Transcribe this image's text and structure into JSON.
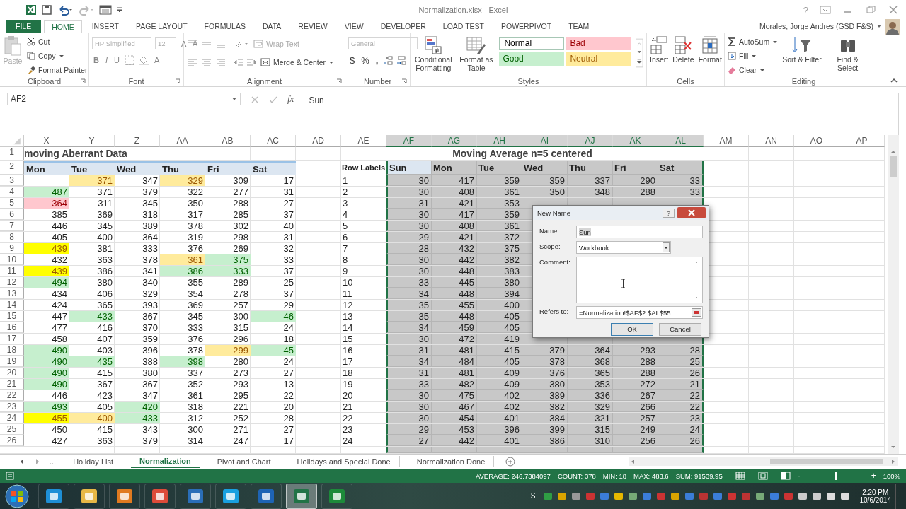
{
  "window": {
    "title": "Normalization.xlsx - Excel",
    "help": "?"
  },
  "menu_tabs": [
    {
      "label": "FILE",
      "kind": "file",
      "selected": false
    },
    {
      "label": "HOME",
      "kind": "tab",
      "selected": true
    },
    {
      "label": "INSERT",
      "kind": "tab",
      "selected": false
    },
    {
      "label": "PAGE LAYOUT",
      "kind": "tab",
      "selected": false
    },
    {
      "label": "FORMULAS",
      "kind": "tab",
      "selected": false
    },
    {
      "label": "DATA",
      "kind": "tab",
      "selected": false
    },
    {
      "label": "REVIEW",
      "kind": "tab",
      "selected": false
    },
    {
      "label": "VIEW",
      "kind": "tab",
      "selected": false
    },
    {
      "label": "DEVELOPER",
      "kind": "tab",
      "selected": false
    },
    {
      "label": "LOAD TEST",
      "kind": "tab",
      "selected": false
    },
    {
      "label": "POWERPIVOT",
      "kind": "tab",
      "selected": false
    },
    {
      "label": "TEAM",
      "kind": "tab",
      "selected": false
    }
  ],
  "user": {
    "name": "Morales, Jorge Andres (GSD F&S)"
  },
  "ribbon": {
    "clipboard": {
      "label": "Clipboard",
      "paste": "Paste",
      "cut": "Cut",
      "copy": "Copy",
      "format_painter": "Format Painter"
    },
    "font": {
      "label": "Font",
      "font_name": "HP Simplified",
      "font_size": "12",
      "grow": "A",
      "shrink": "A",
      "bold": "B",
      "italic": "I",
      "underline": "U",
      "font_color": "A"
    },
    "alignment": {
      "label": "Alignment",
      "wrap_text": "Wrap Text",
      "merge_center": "Merge & Center"
    },
    "number": {
      "label": "Number",
      "format": "General",
      "currency": "$",
      "percent": "%",
      "comma": ","
    },
    "styles": {
      "label": "Styles",
      "conditional": "Conditional Formatting",
      "format_table": "Format as Table",
      "cell_styles": [
        {
          "label": "Normal",
          "kind": "normal"
        },
        {
          "label": "Bad",
          "kind": "bad"
        },
        {
          "label": "Good",
          "kind": "good"
        },
        {
          "label": "Neutral",
          "kind": "neutral"
        }
      ]
    },
    "cells": {
      "label": "Cells",
      "insert": "Insert",
      "delete": "Delete",
      "format": "Format"
    },
    "editing": {
      "label": "Editing",
      "autosum": "AutoSum",
      "fill": "Fill",
      "clear": "Clear",
      "sort_filter": "Sort & Filter",
      "find_select": "Find & Select"
    }
  },
  "formula_bar": {
    "name_box": "AF2",
    "fx": "fx",
    "formula": "Sun"
  },
  "sheet": {
    "columns": [
      {
        "label": "X",
        "selected": false
      },
      {
        "label": "Y",
        "selected": false
      },
      {
        "label": "Z",
        "selected": false
      },
      {
        "label": "AA",
        "selected": false
      },
      {
        "label": "AB",
        "selected": false
      },
      {
        "label": "AC",
        "selected": false
      },
      {
        "label": "AD",
        "selected": false
      },
      {
        "label": "AE",
        "selected": false
      },
      {
        "label": "AF",
        "selected": true
      },
      {
        "label": "AG",
        "selected": true
      },
      {
        "label": "AH",
        "selected": true
      },
      {
        "label": "AI",
        "selected": true
      },
      {
        "label": "AJ",
        "selected": true
      },
      {
        "label": "AK",
        "selected": true
      },
      {
        "label": "AL",
        "selected": true
      },
      {
        "label": "AM",
        "selected": false
      },
      {
        "label": "AN",
        "selected": false
      },
      {
        "label": "AO",
        "selected": false
      },
      {
        "label": "AP",
        "selected": false
      }
    ],
    "row_numbers": [
      "1",
      "2",
      "3",
      "4",
      "5",
      "6",
      "7",
      "8",
      "9",
      "10",
      "11",
      "12",
      "13",
      "14",
      "15",
      "16",
      "17",
      "18",
      "19",
      "20",
      "21",
      "22",
      "23",
      "24",
      "25",
      "26"
    ],
    "title_left": "moving Aberrant Data",
    "title_right": "Moving Average n=5 centered",
    "left_headers": [
      "Mon",
      "Tue",
      "Wed",
      "Thu",
      "Fri",
      "Sat"
    ],
    "left_rows": [
      {
        "tue": {
          "text": "371",
          "kind": "neutral"
        },
        "wed": "347",
        "thu": {
          "text": "329",
          "kind": "neutral"
        },
        "fri": "309",
        "sat": "17"
      },
      {
        "mon": {
          "text": "487",
          "kind": "good"
        },
        "tue": "371",
        "wed": "379",
        "thu": "322",
        "fri": "277",
        "sat": "31"
      },
      {
        "mon": {
          "text": "364",
          "kind": "bad"
        },
        "tue": "311",
        "wed": "345",
        "thu": "350",
        "fri": "288",
        "sat": "27"
      },
      {
        "mon": "385",
        "tue": "369",
        "wed": "318",
        "thu": "317",
        "fri": "285",
        "sat": "37"
      },
      {
        "mon": "446",
        "tue": "345",
        "wed": "389",
        "thu": "378",
        "fri": "302",
        "sat": "40"
      },
      {
        "mon": "405",
        "tue": "400",
        "wed": "364",
        "thu": "319",
        "fri": "298",
        "sat": "31"
      },
      {
        "mon": {
          "text": "439",
          "kind": "highlight"
        },
        "tue": "381",
        "wed": "333",
        "thu": "376",
        "fri": "269",
        "sat": "32"
      },
      {
        "mon": "432",
        "tue": "363",
        "wed": "378",
        "thu": {
          "text": "361",
          "kind": "neutral"
        },
        "fri": {
          "text": "375",
          "kind": "good"
        },
        "sat": "33"
      },
      {
        "mon": {
          "text": "439",
          "kind": "highlight"
        },
        "tue": "386",
        "wed": "341",
        "thu": {
          "text": "386",
          "kind": "good"
        },
        "fri": {
          "text": "333",
          "kind": "good"
        },
        "sat": "37"
      },
      {
        "mon": {
          "text": "494",
          "kind": "good"
        },
        "tue": "380",
        "wed": "340",
        "thu": "355",
        "fri": "289",
        "sat": "25"
      },
      {
        "mon": "434",
        "tue": "406",
        "wed": "329",
        "thu": "354",
        "fri": "278",
        "sat": "37"
      },
      {
        "mon": "424",
        "tue": "365",
        "wed": "393",
        "thu": "369",
        "fri": "257",
        "sat": "29"
      },
      {
        "mon": "447",
        "tue": {
          "text": "433",
          "kind": "good"
        },
        "wed": "367",
        "thu": "345",
        "fri": "300",
        "sat": {
          "text": "46",
          "kind": "good"
        }
      },
      {
        "mon": "477",
        "tue": "416",
        "wed": "370",
        "thu": "333",
        "fri": "315",
        "sat": "24"
      },
      {
        "mon": "458",
        "tue": "407",
        "wed": "359",
        "thu": "376",
        "fri": "296",
        "sat": "18"
      },
      {
        "mon": {
          "text": "490",
          "kind": "good"
        },
        "tue": "403",
        "wed": "396",
        "thu": "378",
        "fri": {
          "text": "299",
          "kind": "neutral"
        },
        "sat": {
          "text": "45",
          "kind": "good"
        }
      },
      {
        "mon": {
          "text": "490",
          "kind": "good"
        },
        "tue": {
          "text": "435",
          "kind": "good"
        },
        "wed": "388",
        "thu": {
          "text": "398",
          "kind": "good"
        },
        "fri": "280",
        "sat": "24"
      },
      {
        "mon": {
          "text": "490",
          "kind": "good"
        },
        "tue": "415",
        "wed": "380",
        "thu": "337",
        "fri": "273",
        "sat": "27"
      },
      {
        "mon": {
          "text": "490",
          "kind": "good"
        },
        "tue": "367",
        "wed": "367",
        "thu": "352",
        "fri": "293",
        "sat": "13"
      },
      {
        "mon": "446",
        "tue": "423",
        "wed": "347",
        "thu": "361",
        "fri": "295",
        "sat": "22"
      },
      {
        "mon": {
          "text": "493",
          "kind": "good"
        },
        "tue": "405",
        "wed": {
          "text": "420",
          "kind": "good"
        },
        "thu": "318",
        "fri": "221",
        "sat": "20"
      },
      {
        "mon": {
          "text": "455",
          "kind": "highlight"
        },
        "tue": {
          "text": "400",
          "kind": "neutral"
        },
        "wed": {
          "text": "433",
          "kind": "good"
        },
        "thu": "312",
        "fri": "252",
        "sat": "28"
      },
      {
        "mon": "450",
        "tue": "415",
        "wed": "343",
        "thu": "300",
        "fri": "271",
        "sat": "27"
      },
      {
        "mon": "427",
        "tue": "363",
        "wed": "379",
        "thu": "314",
        "fri": "247",
        "sat": "17"
      }
    ],
    "right_selected": true,
    "right_headers": [
      {
        "text": "Row Labels",
        "active": false
      },
      {
        "text": "Sun",
        "active": true
      },
      {
        "text": "Mon",
        "active": false
      },
      {
        "text": "Tue",
        "active": false
      },
      {
        "text": "Wed",
        "active": false
      },
      {
        "text": "Thu",
        "active": false
      },
      {
        "text": "Fri",
        "active": false
      },
      {
        "text": "Sat",
        "active": false
      }
    ],
    "right_rows": [
      {
        "label": "1",
        "values": [
          "30",
          "417",
          "359",
          "359",
          "337",
          "290",
          "33"
        ]
      },
      {
        "label": "2",
        "values": [
          "30",
          "408",
          "361",
          "350",
          "348",
          "288",
          "33"
        ]
      },
      {
        "label": "3",
        "values": [
          "31",
          "421",
          "353"
        ]
      },
      {
        "label": "4",
        "values": [
          "30",
          "417",
          "359"
        ]
      },
      {
        "label": "5",
        "values": [
          "30",
          "408",
          "361"
        ]
      },
      {
        "label": "6",
        "values": [
          "29",
          "421",
          "372"
        ]
      },
      {
        "label": "7",
        "values": [
          "28",
          "432",
          "375"
        ]
      },
      {
        "label": "8",
        "values": [
          "30",
          "442",
          "382"
        ]
      },
      {
        "label": "9",
        "values": [
          "30",
          "448",
          "383"
        ]
      },
      {
        "label": "10",
        "values": [
          "33",
          "445",
          "380"
        ]
      },
      {
        "label": "11",
        "values": [
          "34",
          "448",
          "394"
        ]
      },
      {
        "label": "12",
        "values": [
          "35",
          "455",
          "400"
        ]
      },
      {
        "label": "13",
        "values": [
          "35",
          "448",
          "405"
        ]
      },
      {
        "label": "14",
        "values": [
          "34",
          "459",
          "405"
        ]
      },
      {
        "label": "15",
        "values": [
          "30",
          "472",
          "419"
        ]
      },
      {
        "label": "16",
        "values": [
          "31",
          "481",
          "415",
          "379",
          "364",
          "293",
          "28"
        ]
      },
      {
        "label": "17",
        "values": [
          "34",
          "484",
          "405",
          "378",
          "368",
          "288",
          "25"
        ]
      },
      {
        "label": "18",
        "values": [
          "31",
          "481",
          "409",
          "376",
          "365",
          "288",
          "26"
        ]
      },
      {
        "label": "19",
        "values": [
          "33",
          "482",
          "409",
          "380",
          "353",
          "272",
          "21"
        ]
      },
      {
        "label": "20",
        "values": [
          "30",
          "475",
          "402",
          "389",
          "336",
          "267",
          "22"
        ]
      },
      {
        "label": "21",
        "values": [
          "30",
          "467",
          "402",
          "382",
          "329",
          "266",
          "22"
        ]
      },
      {
        "label": "22",
        "values": [
          "30",
          "454",
          "401",
          "384",
          "321",
          "257",
          "23"
        ]
      },
      {
        "label": "23",
        "values": [
          "29",
          "453",
          "396",
          "399",
          "315",
          "249",
          "24"
        ]
      },
      {
        "label": "24",
        "values": [
          "27",
          "442",
          "401",
          "386",
          "310",
          "256",
          "26"
        ]
      }
    ]
  },
  "dialog": {
    "title": "New Name",
    "help": "?",
    "name_label": "Name:",
    "name_value": "Sun",
    "scope_label": "Scope:",
    "scope_value": "Workbook",
    "comment_label": "Comment:",
    "refers_label": "Refers to:",
    "refers_value": "=Normalization!$AF$2:$AL$55",
    "ok": "OK",
    "cancel": "Cancel"
  },
  "sheet_tabs": {
    "more": "...",
    "tabs": [
      {
        "label": "Holiday List",
        "selected": false
      },
      {
        "label": "Normalization",
        "selected": true
      },
      {
        "label": "Pivot and Chart",
        "selected": false
      },
      {
        "label": "Holidays and Special Done",
        "selected": false
      },
      {
        "label": "Normalization Done",
        "selected": false
      }
    ]
  },
  "status_bar": {
    "stats": [
      "AVERAGE: 246.7384097",
      "COUNT: 378",
      "MIN: 18",
      "MAX: 483.6",
      "SUM: 91539.95"
    ],
    "zoom_minus": "-",
    "zoom_plus": "+",
    "zoom": {
      "level": 0.5
    },
    "zoom_percent": "100%"
  },
  "taskbar": {
    "apps": [
      {
        "selected": false
      },
      {
        "selected": false
      },
      {
        "selected": false
      },
      {
        "selected": false
      },
      {
        "selected": false
      },
      {
        "selected": false
      },
      {
        "selected": false
      },
      {
        "selected": true
      },
      {
        "selected": false
      }
    ],
    "language": "ES",
    "time": "2:20 PM",
    "date": "10/6/2014"
  }
}
